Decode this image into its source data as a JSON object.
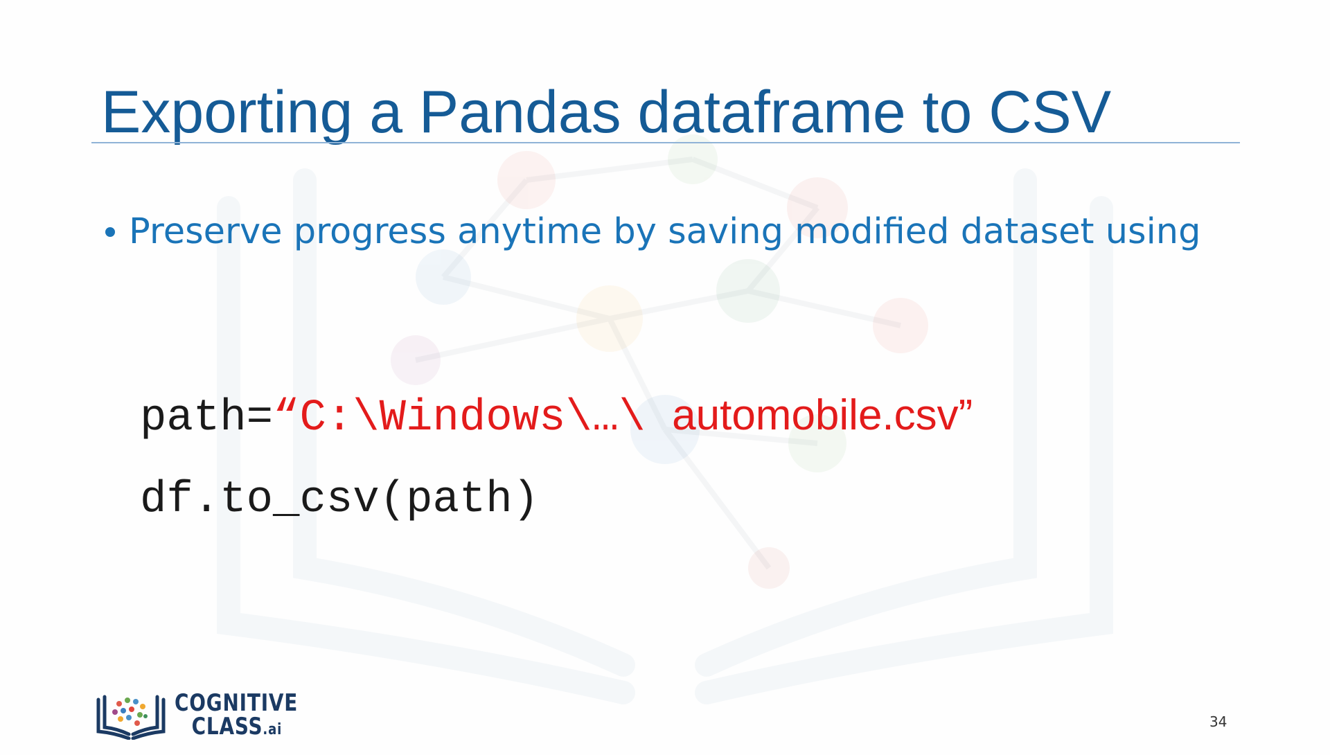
{
  "slide": {
    "title": "Exporting a Pandas dataframe to CSV",
    "bullets": [
      "Preserve progress anytime by saving modified dataset using"
    ],
    "code": {
      "line1": {
        "prefix": "path=",
        "string_mono": "“C:\\Windows\\…\\ ",
        "string_sans": "automobile.csv”"
      },
      "line2": "df.to_csv(path)"
    },
    "page_number": "34"
  },
  "logo": {
    "line1": "COGNITIVE",
    "line2": "CLASS",
    "suffix": ".ai"
  },
  "colors": {
    "title": "#155b96",
    "bullet": "#1a74b8",
    "code": "#1a1a1a",
    "string": "#e31b1b",
    "logo": "#1b3a63"
  }
}
